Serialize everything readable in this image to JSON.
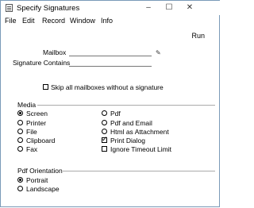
{
  "window": {
    "title": "Specify Signatures",
    "minimize": "–",
    "maximize": "☐",
    "close": "✕"
  },
  "menu": [
    "File",
    "Edit",
    "Record",
    "Window",
    "Info"
  ],
  "toolbar": {
    "run_label": "Run"
  },
  "form": {
    "mailbox_label": "Mailbox",
    "mailbox_value": "",
    "signature_contains_label": "Signature Contains",
    "signature_contains_value": "",
    "skip_label": "Skip all mailboxes without a signature",
    "skip_checked": false
  },
  "media": {
    "title": "Media",
    "options_left": [
      "Screen",
      "Printer",
      "File",
      "Clipboard",
      "Fax"
    ],
    "options_right": [
      "Pdf",
      "Pdf and Email",
      "Html as Attachment"
    ],
    "selected": "Screen",
    "print_dialog_label": "Print Dialog",
    "print_dialog_checked": true,
    "ignore_timeout_label": "Ignore Timeout Limit",
    "ignore_timeout_checked": false
  },
  "pdf_orientation": {
    "title": "Pdf Orientation",
    "options": [
      "Portrait",
      "Landscape"
    ],
    "selected": "Portrait"
  }
}
